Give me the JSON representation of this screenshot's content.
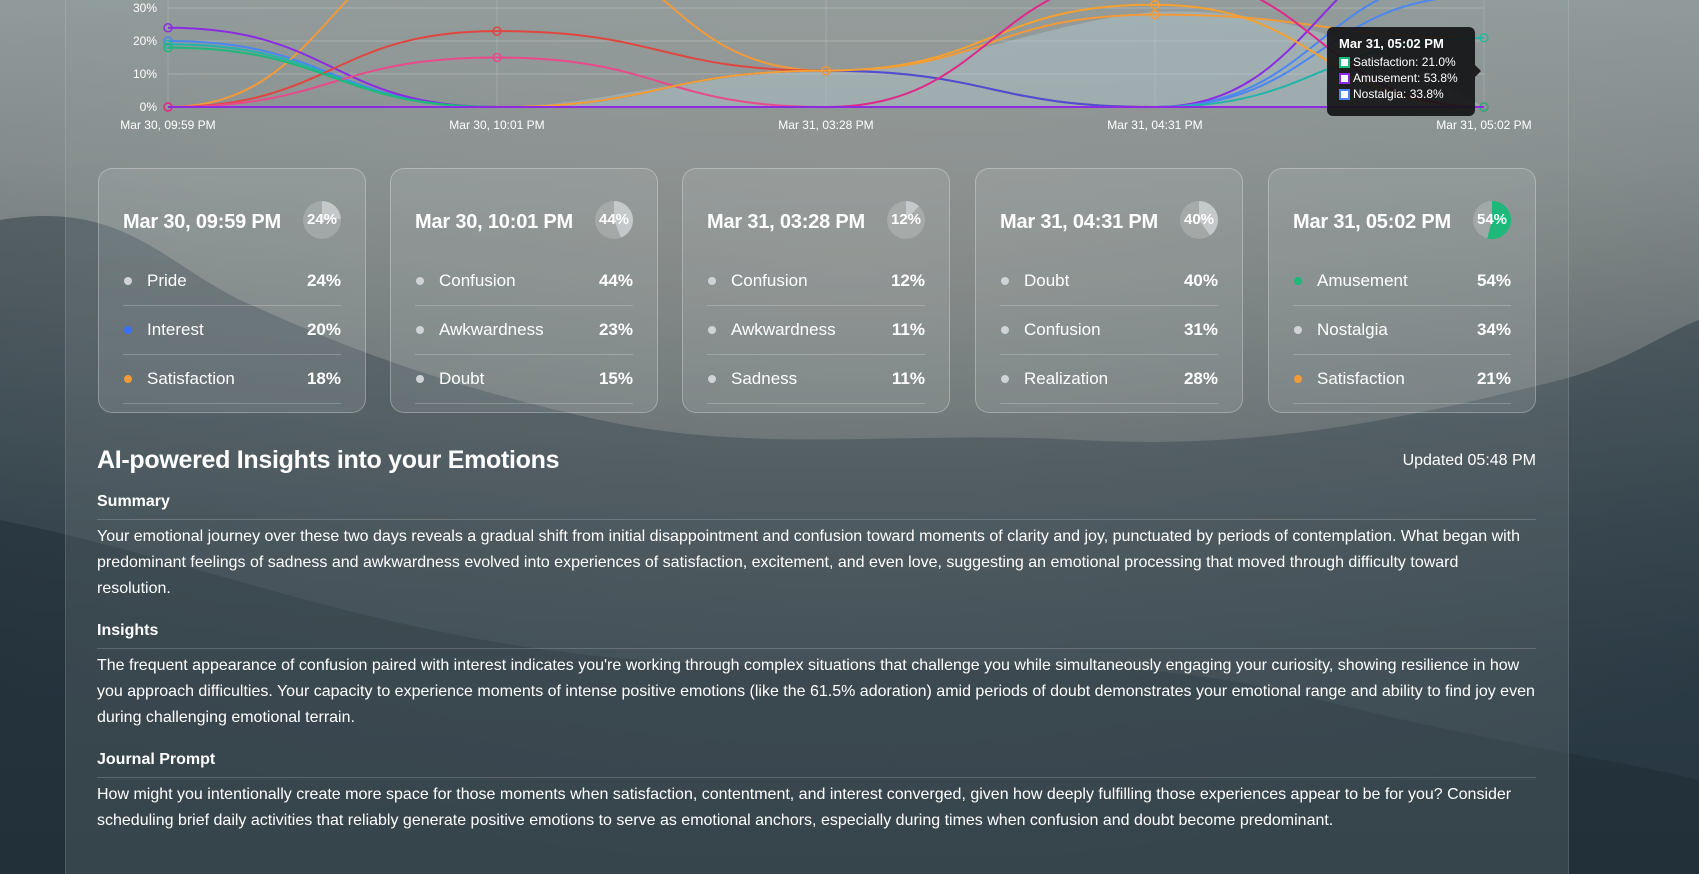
{
  "colors": {
    "pride": "#cfd3d6",
    "interest": "#3b6ff5",
    "satisfaction": "#f29a38",
    "neutral_dot": "#cfd3d6",
    "amusement_dot": "#1db87a",
    "line_red": "#e0463f",
    "line_pink": "#e84a8a",
    "line_magenta": "#e0288a",
    "line_orange": "#f29a38",
    "line_orange2": "#f5a030",
    "line_purple": "#8b2be2",
    "line_indigo": "#4b4fd8",
    "line_blue": "#4c86f0",
    "line_teal": "#22b4a8",
    "line_green": "#1db87a"
  },
  "chart_data": {
    "type": "line",
    "categories": [
      "Mar 30, 09:59 PM",
      "Mar 30, 10:01 PM",
      "Mar 31, 03:28 PM",
      "Mar 31, 04:31 PM",
      "Mar 31, 05:02 PM"
    ],
    "y_ticks": [
      "0%",
      "10%",
      "20%",
      "30%"
    ],
    "ylim": [
      0,
      35
    ],
    "grid": true,
    "series": [
      {
        "name": "Interest",
        "values": [
          20,
          0,
          0,
          0,
          40
        ],
        "color_key": "line_blue"
      },
      {
        "name": "Satisfaction",
        "values": [
          0,
          55,
          11,
          28,
          21
        ],
        "color_key": "line_orange"
      },
      {
        "name": "Amusement",
        "values": [
          24,
          0,
          0,
          0,
          53.8
        ],
        "color_key": "line_purple"
      },
      {
        "name": "Nostalgia",
        "values": [
          0,
          0,
          0,
          0,
          33.8
        ],
        "color_key": "line_blue"
      },
      {
        "values": [
          19,
          0,
          0,
          0,
          21
        ],
        "color_key": "line_teal"
      },
      {
        "values": [
          0,
          23,
          11,
          0,
          0
        ],
        "color_key": "line_red"
      },
      {
        "values": [
          0,
          15,
          0,
          0,
          0
        ],
        "color_key": "line_pink"
      },
      {
        "values": [
          0,
          0,
          11,
          0,
          0
        ],
        "color_key": "line_indigo"
      },
      {
        "values": [
          0,
          0,
          11,
          31,
          0
        ],
        "color_key": "line_orange2"
      },
      {
        "values": [
          0,
          0,
          0,
          40,
          0
        ],
        "color_key": "line_magenta"
      },
      {
        "values": [
          18,
          0,
          0,
          0,
          0
        ],
        "color_key": "line_green"
      }
    ],
    "tooltip": {
      "title": "Mar 31, 05:02 PM",
      "rows": [
        {
          "label": "Satisfaction: 21.0%",
          "color": "#1db87a"
        },
        {
          "label": "Amusement: 53.8%",
          "color": "#8b2be2"
        },
        {
          "label": "Nostalgia: 33.8%",
          "color": "#4c86f0"
        }
      ]
    }
  },
  "cards": [
    {
      "title": "Mar 30, 09:59 PM",
      "donut_value": 24,
      "donut_label": "24%",
      "donut_color": "#cfd3d6",
      "rows": [
        {
          "name": "Pride",
          "pct": "24%",
          "dot": "#cfd3d6"
        },
        {
          "name": "Interest",
          "pct": "20%",
          "dot": "#3b6ff5"
        },
        {
          "name": "Satisfaction",
          "pct": "18%",
          "dot": "#f29a38"
        }
      ]
    },
    {
      "title": "Mar 30, 10:01 PM",
      "donut_value": 44,
      "donut_label": "44%",
      "donut_color": "#cfd3d6",
      "rows": [
        {
          "name": "Confusion",
          "pct": "44%",
          "dot": "#cfd3d6"
        },
        {
          "name": "Awkwardness",
          "pct": "23%",
          "dot": "#cfd3d6"
        },
        {
          "name": "Doubt",
          "pct": "15%",
          "dot": "#cfd3d6"
        }
      ]
    },
    {
      "title": "Mar 31, 03:28 PM",
      "donut_value": 12,
      "donut_label": "12%",
      "donut_color": "#cfd3d6",
      "rows": [
        {
          "name": "Confusion",
          "pct": "12%",
          "dot": "#cfd3d6"
        },
        {
          "name": "Awkwardness",
          "pct": "11%",
          "dot": "#cfd3d6"
        },
        {
          "name": "Sadness",
          "pct": "11%",
          "dot": "#cfd3d6"
        }
      ]
    },
    {
      "title": "Mar 31, 04:31 PM",
      "donut_value": 40,
      "donut_label": "40%",
      "donut_color": "#cfd3d6",
      "rows": [
        {
          "name": "Doubt",
          "pct": "40%",
          "dot": "#cfd3d6"
        },
        {
          "name": "Confusion",
          "pct": "31%",
          "dot": "#cfd3d6"
        },
        {
          "name": "Realization",
          "pct": "28%",
          "dot": "#cfd3d6"
        }
      ]
    },
    {
      "title": "Mar 31, 05:02 PM",
      "donut_value": 54,
      "donut_label": "54%",
      "donut_color": "#1db87a",
      "rows": [
        {
          "name": "Amusement",
          "pct": "54%",
          "dot": "#1db87a"
        },
        {
          "name": "Nostalgia",
          "pct": "34%",
          "dot": "#cfd3d6"
        },
        {
          "name": "Satisfaction",
          "pct": "21%",
          "dot": "#f29a38"
        }
      ]
    }
  ],
  "insights": {
    "title": "AI-powered Insights into your Emotions",
    "updated": "Updated 05:48 PM",
    "sections": [
      {
        "heading": "Summary",
        "body": "Your emotional journey over these two days reveals a gradual shift from initial disappointment and confusion toward moments of clarity and joy, punctuated by periods of contemplation. What began with predominant feelings of sadness and awkwardness evolved into experiences of satisfaction, excitement, and even love, suggesting an emotional processing that moved through difficulty toward resolution."
      },
      {
        "heading": "Insights",
        "body": "The frequent appearance of confusion paired with interest indicates you're working through complex situations that challenge you while simultaneously engaging your curiosity, showing resilience in how you approach difficulties. Your capacity to experience moments of intense positive emotions (like the 61.5% adoration) amid periods of doubt demonstrates your emotional range and ability to find joy even during challenging emotional terrain."
      },
      {
        "heading": "Journal Prompt",
        "body": "How might you intentionally create more space for those moments when satisfaction, contentment, and interest converged, given how deeply fulfilling those experiences appear to be for you? Consider scheduling brief daily activities that reliably generate positive emotions to serve as emotional anchors, especially during times when confusion and doubt become predominant."
      }
    ]
  }
}
